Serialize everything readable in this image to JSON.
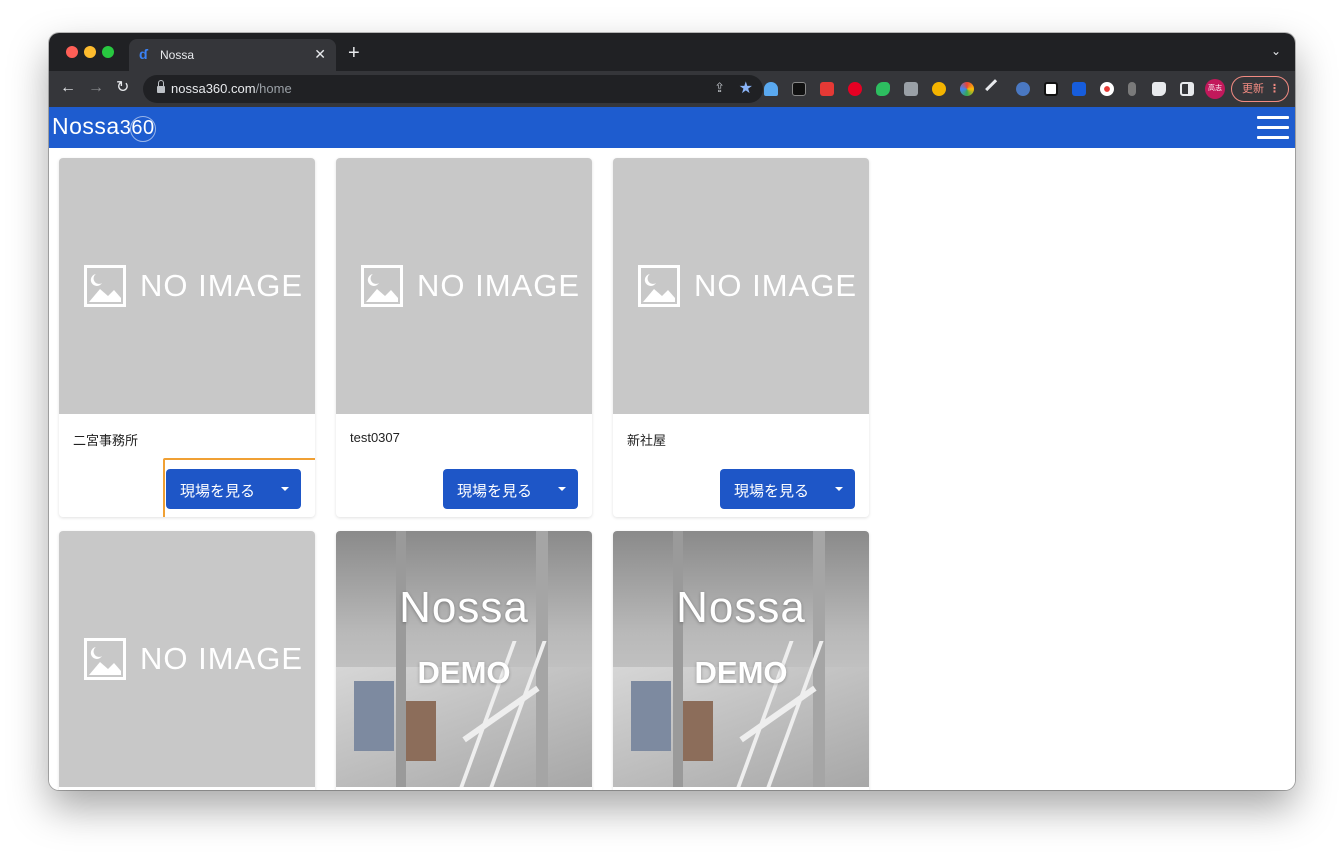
{
  "browser": {
    "tab_title": "Nossa",
    "tab_close": "✕",
    "new_tab": "+",
    "tab_search": "⌄",
    "url_host": "nossa360.com",
    "url_path": "/home",
    "nav_back": "←",
    "nav_forward": "→",
    "nav_reload": "↻",
    "share": "⇪",
    "star": "★",
    "profile_initials": "高志",
    "update_label": "更新",
    "update_menu": "⋮"
  },
  "app": {
    "logo_text": "Nossa",
    "logo_number": "360"
  },
  "cards": [
    {
      "title": "二宮事務所",
      "image": "NO IMAGE",
      "button": "現場を見る"
    },
    {
      "title": "test0307",
      "image": "NO IMAGE",
      "button": "現場を見る"
    },
    {
      "title": "新社屋",
      "image": "NO IMAGE",
      "button": "現場を見る"
    },
    {
      "image": "NO IMAGE"
    },
    {
      "brand": "Nossa",
      "label": "DEMO"
    },
    {
      "brand": "Nossa",
      "label": "DEMO"
    }
  ],
  "colors": {
    "appbar": "#1e5ccf",
    "button": "#1e56c7",
    "highlight": "#f0a034",
    "placeholder": "#c8c8c8"
  }
}
